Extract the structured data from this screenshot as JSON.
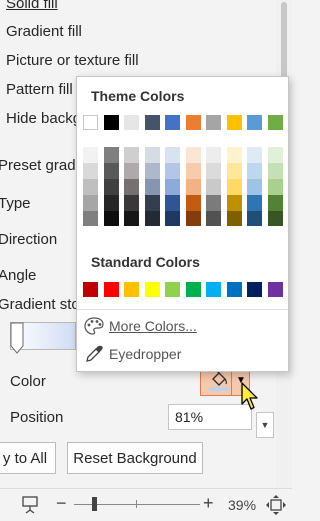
{
  "fill_options": {
    "solid_fill": "Solid fill",
    "gradient_fill": "Gradient fill",
    "picture_fill": "Picture or texture fill",
    "pattern_fill": "Pattern fill",
    "hide_background": "Hide backg"
  },
  "labels": {
    "preset_gradients": "Preset gradie",
    "type": "Type",
    "direction": "Direction",
    "angle": "Angle",
    "gradient_stops": "Gradient sto",
    "color": "Color",
    "position": "Position"
  },
  "position_value": "81%",
  "buttons": {
    "apply_to_all": "y to All",
    "reset_background": "Reset Background"
  },
  "palette": {
    "theme_title": "Theme Colors",
    "standard_title": "Standard Colors",
    "more_colors": "More Colors...",
    "eyedropper": "Eyedropper",
    "theme_colors": [
      [
        "#ffffff",
        "#f2f2f2",
        "#d9d9d9",
        "#bfbfbf",
        "#a6a6a6",
        "#7f7f7f"
      ],
      [
        "#000000",
        "#7f7f7f",
        "#595959",
        "#404040",
        "#262626",
        "#0d0d0d"
      ],
      [
        "#e7e6e6",
        "#d0cece",
        "#aeaaaa",
        "#757171",
        "#3a3838",
        "#171616"
      ],
      [
        "#44546a",
        "#d6dce4",
        "#adb9ca",
        "#8496b0",
        "#333f4f",
        "#222a35"
      ],
      [
        "#4472c4",
        "#d9e2f3",
        "#b4c6e7",
        "#8eaadb",
        "#2f5597",
        "#1f3864"
      ],
      [
        "#ed7d31",
        "#fbe5d5",
        "#f8cbad",
        "#f4b183",
        "#c55a11",
        "#843c0c"
      ],
      [
        "#a5a5a5",
        "#ededed",
        "#dbdbdb",
        "#c9c9c9",
        "#7b7b7b",
        "#525252"
      ],
      [
        "#ffc000",
        "#fff2cc",
        "#ffe699",
        "#ffd966",
        "#bf9000",
        "#7f6000"
      ],
      [
        "#5b9bd5",
        "#deebf6",
        "#bdd7ee",
        "#9dc3e6",
        "#2e75b6",
        "#1f4e79"
      ],
      [
        "#70ad47",
        "#e2f0d9",
        "#c5e0b4",
        "#a9d18e",
        "#548235",
        "#375623"
      ]
    ],
    "standard_colors": [
      "#c00000",
      "#ff0000",
      "#ffc000",
      "#ffff00",
      "#92d050",
      "#00b050",
      "#00b0f0",
      "#0070c0",
      "#002060",
      "#7030a0"
    ]
  },
  "status": {
    "zoom": "39%",
    "zoom_slider_level": 0.39
  }
}
